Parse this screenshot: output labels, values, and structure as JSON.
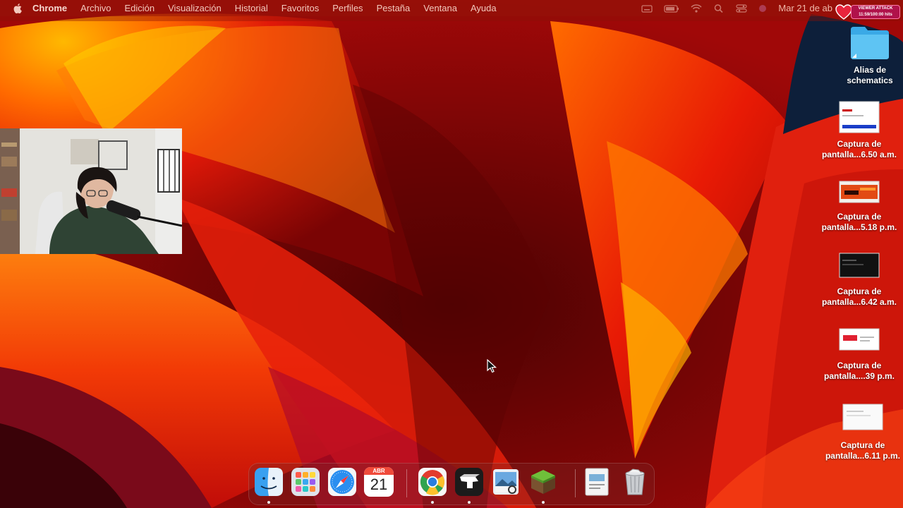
{
  "menubar": {
    "app_name": "Chrome",
    "items": [
      "Archivo",
      "Edición",
      "Visualización",
      "Historial",
      "Favoritos",
      "Perfiles",
      "Pestaña",
      "Ventana",
      "Ayuda"
    ],
    "date": "Mar 21 de ab",
    "status_icons": [
      "keyboard-icon",
      "battery-icon",
      "wifi-icon",
      "search-icon",
      "control-center-icon",
      "siri-icon"
    ]
  },
  "overlay_badge": {
    "title": "VIEWER ATTACK",
    "subtitle": "11:59/100:00 hits"
  },
  "desktop_icons": [
    {
      "name": "folder-alias",
      "line1": "Alias de",
      "line2": "schematics"
    },
    {
      "name": "screenshot-1",
      "line1": "Captura de",
      "line2": "pantalla...6.50 a.m."
    },
    {
      "name": "screenshot-2",
      "line1": "Captura de",
      "line2": "pantalla...5.18 p.m."
    },
    {
      "name": "screenshot-3",
      "line1": "Captura de",
      "line2": "pantalla...6.42 a.m."
    },
    {
      "name": "screenshot-4",
      "line1": "Captura de",
      "line2": "pantalla....39 p.m."
    },
    {
      "name": "screenshot-5",
      "line1": "Captura de",
      "line2": "pantalla...6.11 p.m."
    }
  ],
  "dock": {
    "calendar_month": "ABR",
    "calendar_day": "21",
    "apps": [
      "finder",
      "launchpad",
      "safari",
      "calendar",
      "chrome",
      "unity",
      "preview",
      "minecraft",
      "documents",
      "trash"
    ]
  },
  "colors": {
    "menubar_text": "#f3c9bd",
    "wallpaper_orange": "#ff5a00",
    "wallpaper_red": "#d80a0a",
    "wallpaper_dark": "#3a0202"
  }
}
